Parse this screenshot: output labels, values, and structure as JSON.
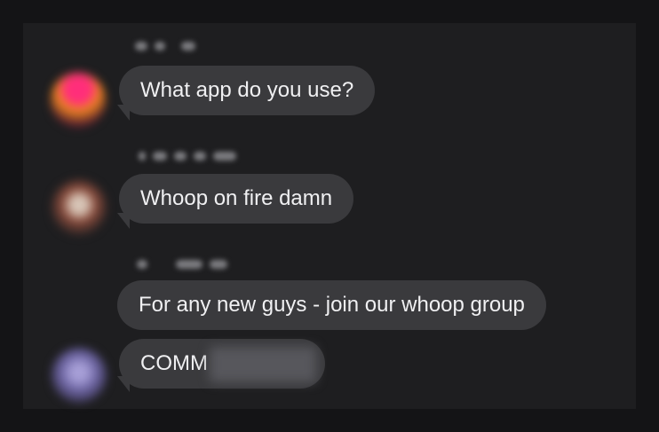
{
  "messages": [
    {
      "text": "What app do you use?"
    },
    {
      "text": "Whoop on fire damn"
    },
    {
      "text": "For any new guys - join our whoop group"
    },
    {
      "text": "COMM"
    }
  ],
  "colors": {
    "background": "#141416",
    "panel": "#1e1e20",
    "bubble": "#3a3a3d",
    "text": "#f0f0f2"
  }
}
